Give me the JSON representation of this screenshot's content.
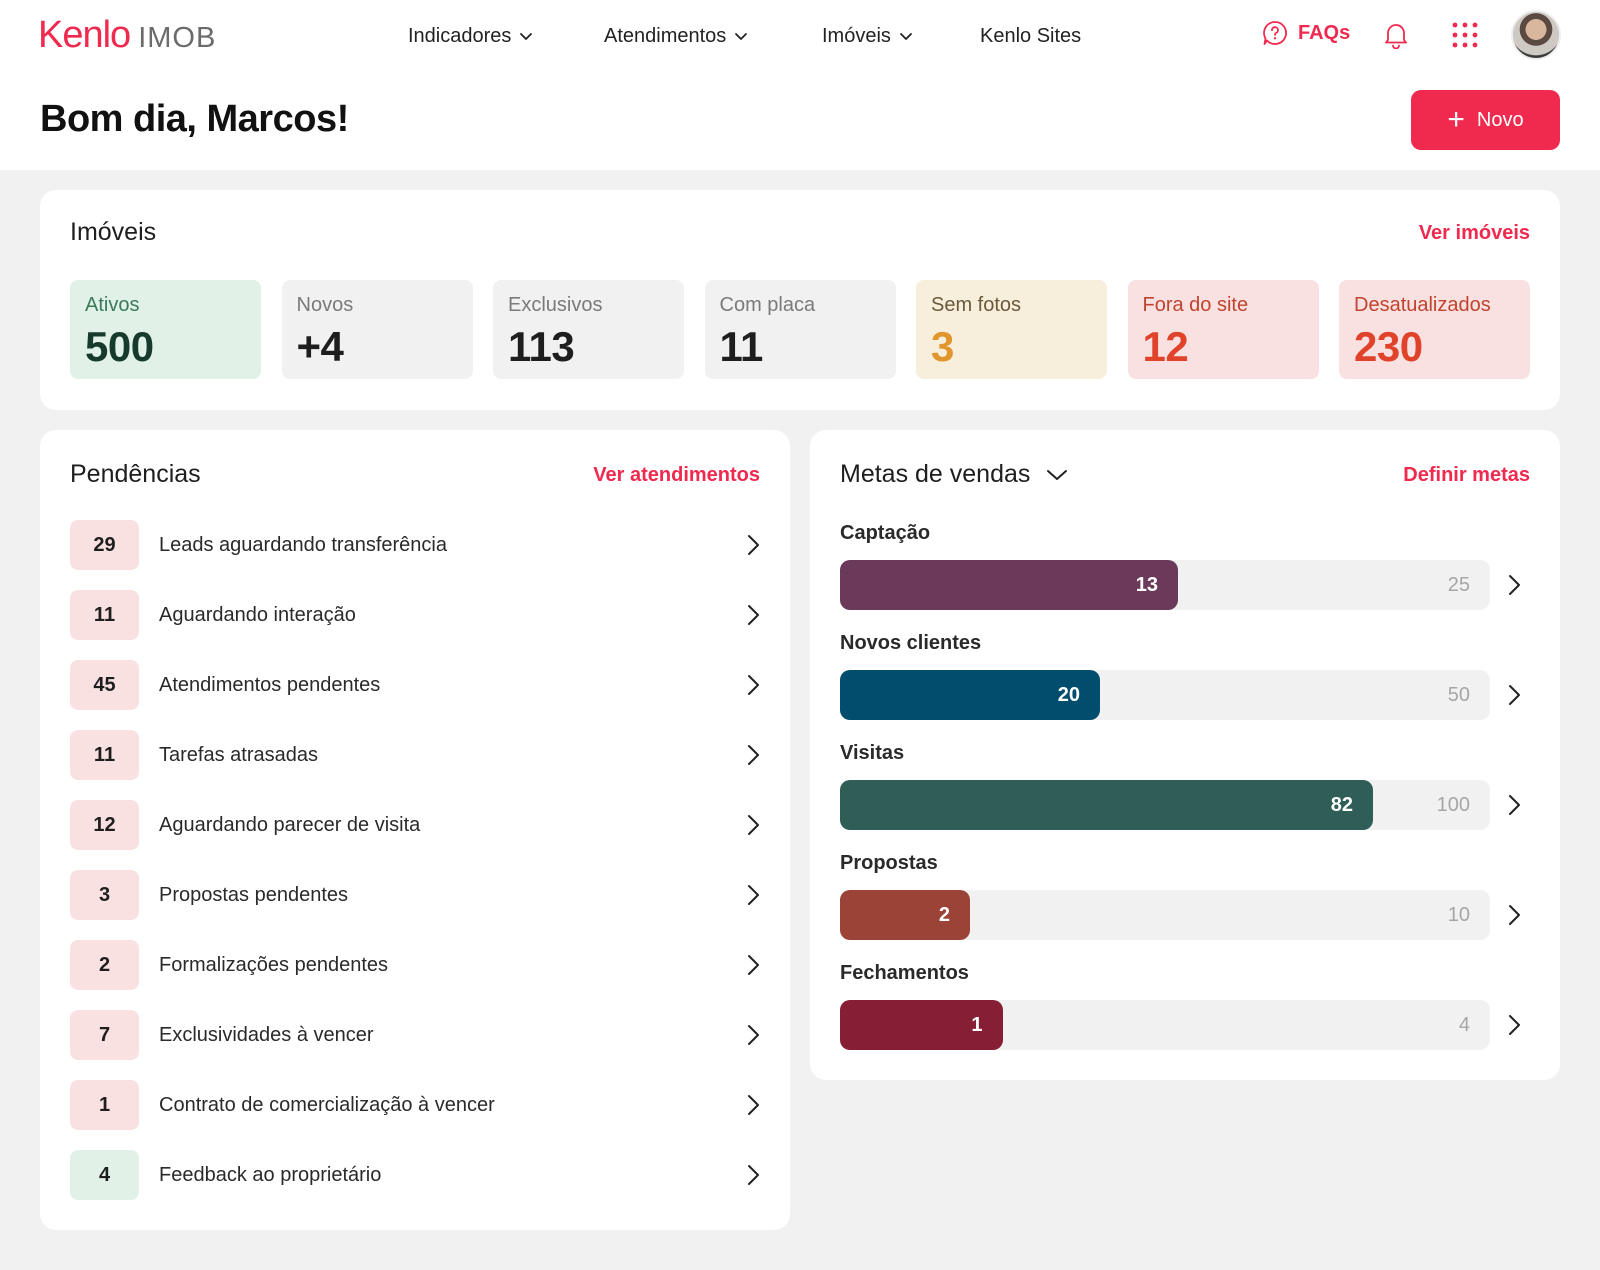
{
  "header": {
    "logo_main": "Kenlo",
    "logo_sub": "IMOB",
    "nav": [
      {
        "label": "Indicadores",
        "has_dropdown": true
      },
      {
        "label": "Atendimentos",
        "has_dropdown": true
      },
      {
        "label": "Imóveis",
        "has_dropdown": true
      },
      {
        "label": "Kenlo Sites",
        "has_dropdown": false
      }
    ],
    "faq_label": "FAQs",
    "icons": [
      "help-circle-icon",
      "bell-icon",
      "apps-grid-icon"
    ],
    "accent_color": "#f0294e"
  },
  "greeting": "Bom dia, Marcos!",
  "new_button_label": "Novo",
  "imoveis": {
    "title": "Imóveis",
    "link": "Ver imóveis",
    "stats": [
      {
        "label": "Ativos",
        "value": "500",
        "bg": "#e1f1e8",
        "label_color": "#3a7a5a",
        "value_color": "#163a2b"
      },
      {
        "label": "Novos",
        "value": "+4",
        "bg": "#f1f1f1",
        "label_color": "#7a7a7a",
        "value_color": "#1e1e1e"
      },
      {
        "label": "Exclusivos",
        "value": "113",
        "bg": "#f1f1f1",
        "label_color": "#7a7a7a",
        "value_color": "#1e1e1e"
      },
      {
        "label": "Com placa",
        "value": "11",
        "bg": "#f1f1f1",
        "label_color": "#7a7a7a",
        "value_color": "#1e1e1e"
      },
      {
        "label": "Sem fotos",
        "value": "3",
        "bg": "#f8eedc",
        "label_color": "#6a5a3a",
        "value_color": "#e0962a"
      },
      {
        "label": "Fora do site",
        "value": "12",
        "bg": "#fae1e1",
        "label_color": "#c0432e",
        "value_color": "#e0422a"
      },
      {
        "label": "Desatualizados",
        "value": "230",
        "bg": "#fae1e1",
        "label_color": "#c0432e",
        "value_color": "#e0422a"
      }
    ]
  },
  "pendencias": {
    "title": "Pendências",
    "link": "Ver atendimentos",
    "items": [
      {
        "count": "29",
        "label": "Leads aguardando transferência",
        "bg": "#fae1e1"
      },
      {
        "count": "11",
        "label": "Aguardando interação",
        "bg": "#fae1e1"
      },
      {
        "count": "45",
        "label": "Atendimentos pendentes",
        "bg": "#fae1e1"
      },
      {
        "count": "11",
        "label": "Tarefas atrasadas",
        "bg": "#fae1e1"
      },
      {
        "count": "12",
        "label": "Aguardando parecer de visita",
        "bg": "#fae1e1"
      },
      {
        "count": "3",
        "label": "Propostas pendentes",
        "bg": "#fae1e1"
      },
      {
        "count": "2",
        "label": "Formalizações pendentes",
        "bg": "#fae1e1"
      },
      {
        "count": "7",
        "label": "Exclusividades à vencer",
        "bg": "#fae1e1"
      },
      {
        "count": "1",
        "label": "Contrato de comercialização à vencer",
        "bg": "#fae1e1"
      },
      {
        "count": "4",
        "label": "Feedback ao proprietário",
        "bg": "#e1f1e8"
      }
    ]
  },
  "metas": {
    "title": "Metas de vendas",
    "link": "Definir metas",
    "goals": [
      {
        "label": "Captação",
        "value": "13",
        "target": "25",
        "progress": 0.52,
        "color": "#6b3a5a"
      },
      {
        "label": "Novos clientes",
        "value": "20",
        "target": "50",
        "progress": 0.4,
        "color": "#004d6e"
      },
      {
        "label": "Visitas",
        "value": "82",
        "target": "100",
        "progress": 0.82,
        "color": "#2e5e56"
      },
      {
        "label": "Propostas",
        "value": "2",
        "target": "10",
        "progress": 0.2,
        "color": "#9a4336"
      },
      {
        "label": "Fechamentos",
        "value": "1",
        "target": "4",
        "progress": 0.25,
        "color": "#861f35"
      }
    ]
  }
}
